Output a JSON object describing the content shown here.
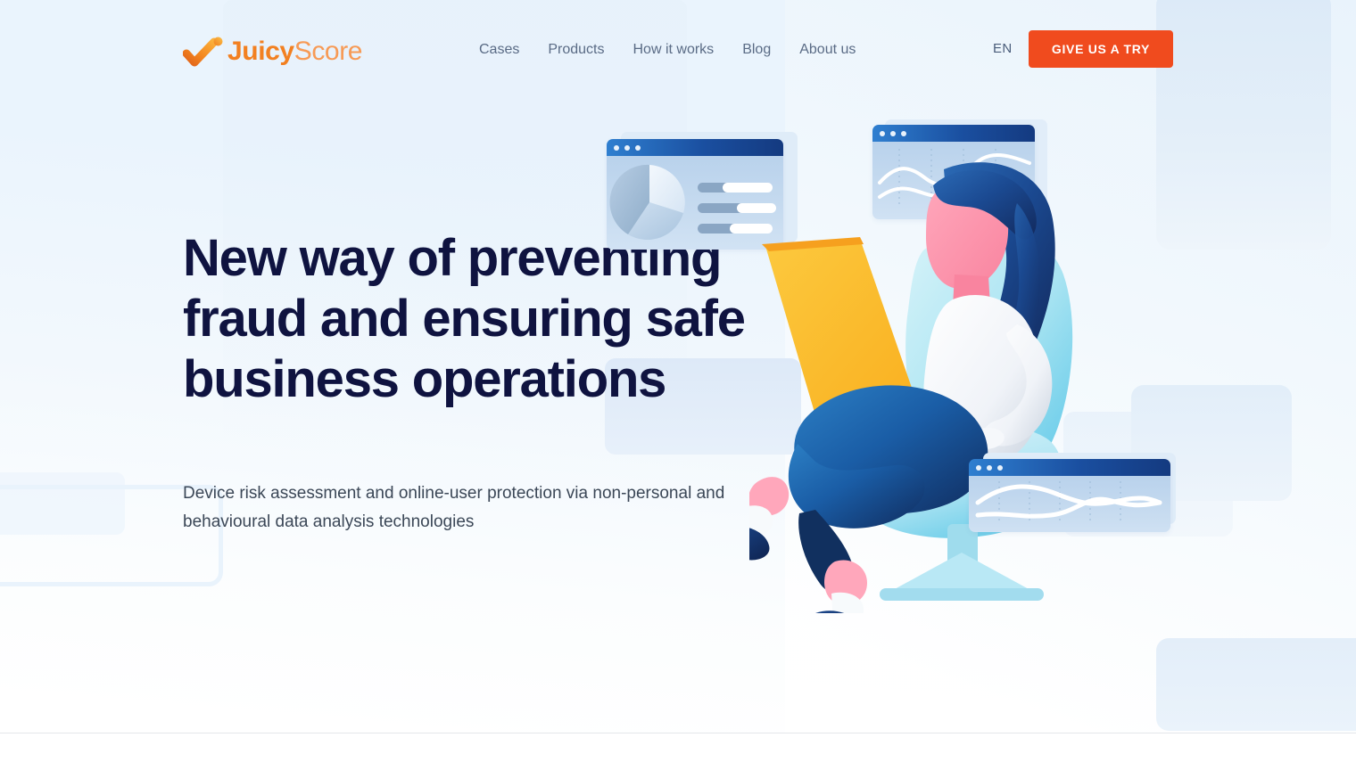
{
  "brand": {
    "name_primary": "Juicy",
    "name_secondary": "Score",
    "logo_icon": "orange-checkmark-icon",
    "accent_orange": "#F28021",
    "accent_orange_light": "#F79A55",
    "cta_color": "#F04B1E"
  },
  "nav": {
    "items": [
      {
        "label": "Cases"
      },
      {
        "label": "Products"
      },
      {
        "label": "How it works"
      },
      {
        "label": "Blog"
      },
      {
        "label": "About us"
      }
    ]
  },
  "header": {
    "language": "EN",
    "cta_label": "GIVE US A TRY"
  },
  "hero": {
    "title": "New way of preventing fraud and ensuring safe business operations",
    "title_color": "#0f1340",
    "subtitle": "Device risk assessment and online-user protection via non-personal and behavioural data analysis technologies",
    "subtitle_color": "#3b4757",
    "background_color": "#eaf4fd"
  },
  "illustration": {
    "description": "woman-sitting-in-armchair-with-laptop",
    "windows": [
      {
        "name": "pie-chart-window",
        "chart": "pie"
      },
      {
        "name": "line-chart-window-top",
        "chart": "line"
      },
      {
        "name": "line-chart-window-bottom",
        "chart": "line"
      }
    ],
    "colors": {
      "hair": "#173a72",
      "skin": "#fb8fa8",
      "sweater": "#eef2f7",
      "jeans": "#13386e",
      "chair": "#b9ecf5",
      "laptop": "#fcba2e"
    }
  }
}
